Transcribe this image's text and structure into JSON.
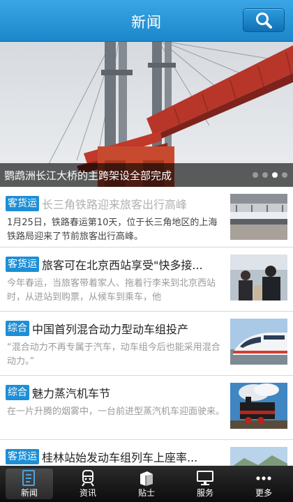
{
  "header": {
    "title": "新闻",
    "search_icon": "search-icon"
  },
  "banner": {
    "caption": "鹦鹉洲长江大桥的主跨架设全部完成",
    "dot_count": 4,
    "active_dot": 2
  },
  "news": [
    {
      "tag": "客货运",
      "title": "长三角铁路迎来旅客出行高峰",
      "title_dim": true,
      "summary": "1月25日，铁路春运第10天，位于长三角地区的上海铁路局迎来了节前旅客出行高峰。",
      "summary_dark": true,
      "thumb": "train-station-thumb"
    },
    {
      "tag": "客货运",
      "title": "旅客可在北京西站享受\"快多接...",
      "title_dim": false,
      "summary": "今年春运，当旅客带着家人、拖着行李来到北京西站时，从进站到购票，从候车到乘车，他",
      "summary_dark": false,
      "thumb": "passengers-thumb"
    },
    {
      "tag": "综合",
      "title": "中国首列混合动力型动车组投产",
      "title_dim": false,
      "summary": "“混合动力不再专属于汽车，动车组今后也能采用混合动力。”",
      "summary_dark": false,
      "thumb": "bullet-train-thumb"
    },
    {
      "tag": "综合",
      "title": "魅力蒸汽机车节",
      "title_dim": false,
      "summary": "在一片升腾的烟雾中，一台前进型蒸汽机车迎面驶来。",
      "summary_dark": false,
      "thumb": "steam-locomotive-thumb"
    },
    {
      "tag": "客货运",
      "title": "桂林站始发动车组列车上座率...",
      "title_dim": false,
      "summary": "",
      "summary_dark": false,
      "thumb": "landscape-thumb"
    }
  ],
  "nav": [
    {
      "label": "新闻",
      "icon": "news-icon",
      "active": true
    },
    {
      "label": "资讯",
      "icon": "train-icon",
      "active": false
    },
    {
      "label": "贴士",
      "icon": "tips-icon",
      "active": false
    },
    {
      "label": "服务",
      "icon": "monitor-icon",
      "active": false
    },
    {
      "label": "更多",
      "icon": "more-icon",
      "active": false
    }
  ],
  "colors": {
    "header": "#1b86c9",
    "tag": "#1d8fd6",
    "nav_bg": "#111111"
  }
}
